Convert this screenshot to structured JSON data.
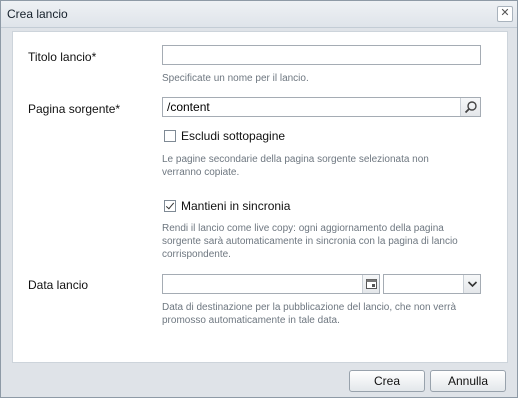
{
  "dialog": {
    "title": "Crea lancio",
    "close_icon_glyph": "✕"
  },
  "form": {
    "titolo": {
      "label": "Titolo lancio",
      "required_mark": "*",
      "value": "",
      "hint": "Specificate un nome per il lancio."
    },
    "pagina": {
      "label": "Pagina sorgente",
      "required_mark": "*",
      "value": "/content",
      "search_icon": "search-icon"
    },
    "escludi": {
      "label": "Escludi sottopagine",
      "checked": false,
      "hint": "Le pagine secondarie della pagina sorgente selezionata non verranno copiate."
    },
    "mantieni": {
      "label": "Mantieni in sincronia",
      "checked": true,
      "hint": "Rendi il lancio come live copy: ogni aggiornamento della pagina sorgente sarà automaticamente in sincronia con la pagina di lancio corrispondente."
    },
    "data": {
      "label": "Data lancio",
      "date_value": "",
      "time_value": "",
      "calendar_icon": "calendar-icon",
      "dropdown_icon": "chevron-down-icon",
      "hint": "Data di destinazione per la pubblicazione del lancio, che non verrà promosso automaticamente in tale data."
    }
  },
  "footer": {
    "create_label": "Crea",
    "cancel_label": "Annulla"
  }
}
